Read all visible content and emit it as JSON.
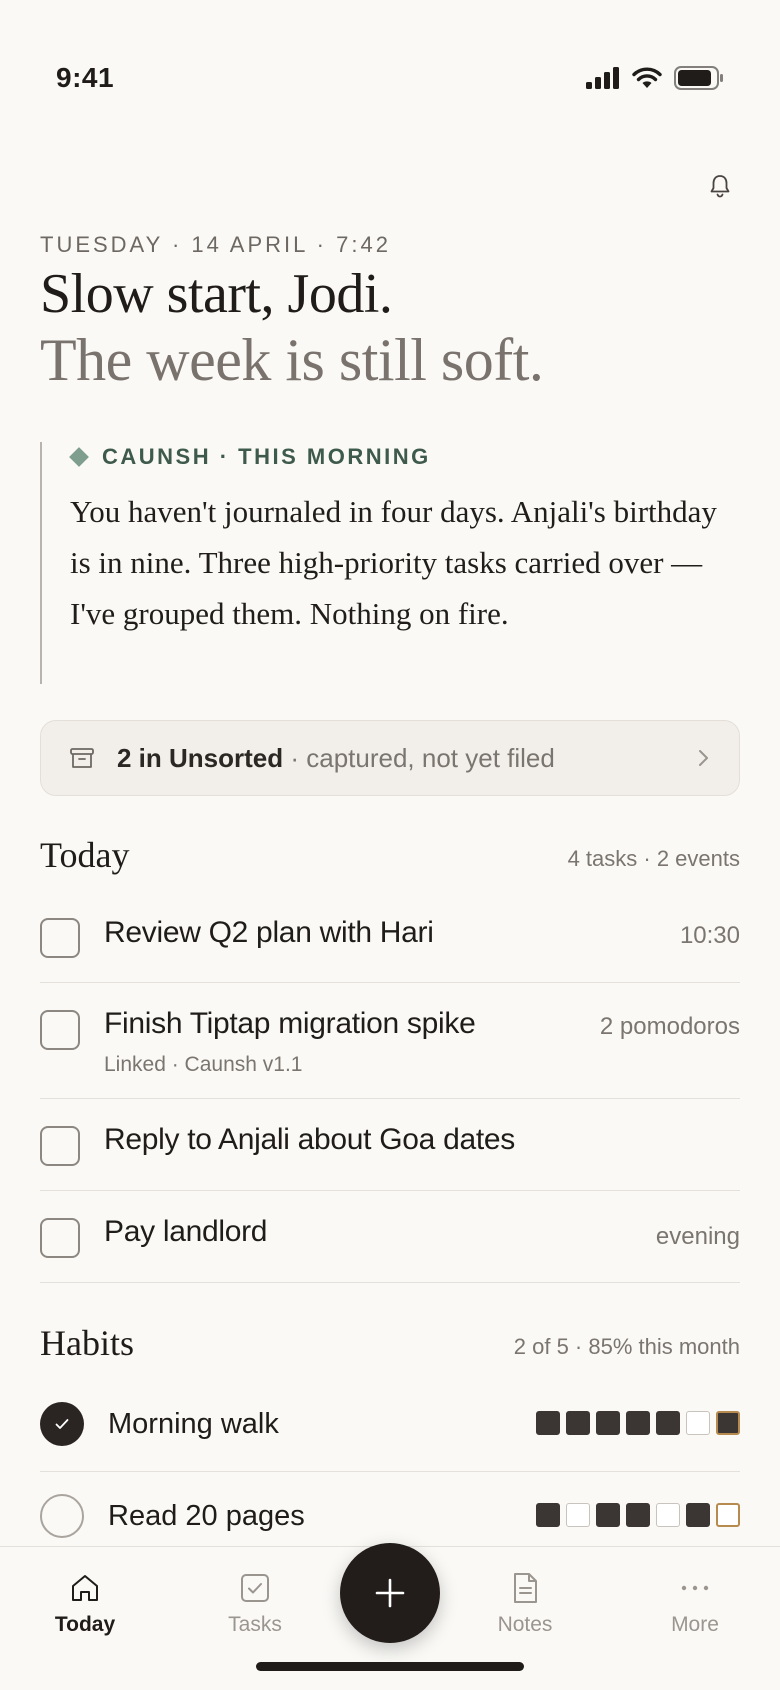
{
  "status": {
    "time": "9:41"
  },
  "header": {
    "eyebrow": "TUESDAY · 14 APRIL · 7:42",
    "greeting": "Slow start, Jodi.",
    "subline": "The week is still soft."
  },
  "briefing": {
    "tag": "CAUNSH · THIS MORNING",
    "body": "You haven't journaled in four days. Anjali's birthday is in nine. Three high-priority tasks carried over — I've grouped them. Nothing on fire."
  },
  "unsorted": {
    "count_label": "2 in Unsorted",
    "detail": " · captured, not yet filed"
  },
  "today": {
    "title": "Today",
    "meta": "4 tasks · 2 events",
    "tasks": [
      {
        "title": "Review Q2 plan with Hari",
        "right": "10:30",
        "sub": ""
      },
      {
        "title": "Finish Tiptap migration spike",
        "right": "2 pomodoros",
        "sub": "Linked · Caunsh v1.1"
      },
      {
        "title": "Reply to Anjali about Goa dates",
        "right": "",
        "sub": ""
      },
      {
        "title": "Pay landlord",
        "right": "evening",
        "sub": ""
      }
    ]
  },
  "habits": {
    "title": "Habits",
    "meta": "2 of 5 · 85% this month",
    "items": [
      {
        "title": "Morning walk",
        "done": true,
        "week": [
          1,
          1,
          1,
          1,
          1,
          0,
          1
        ]
      },
      {
        "title": "Read 20 pages",
        "done": false,
        "week": [
          1,
          0,
          1,
          1,
          0,
          1,
          0
        ]
      }
    ]
  },
  "tabbar": {
    "today": "Today",
    "tasks": "Tasks",
    "notes": "Notes",
    "more": "More"
  },
  "colors": {
    "accent_sage": "#7f9e8e",
    "ink": "#1f1c19",
    "today_outline": "#b78a50"
  }
}
